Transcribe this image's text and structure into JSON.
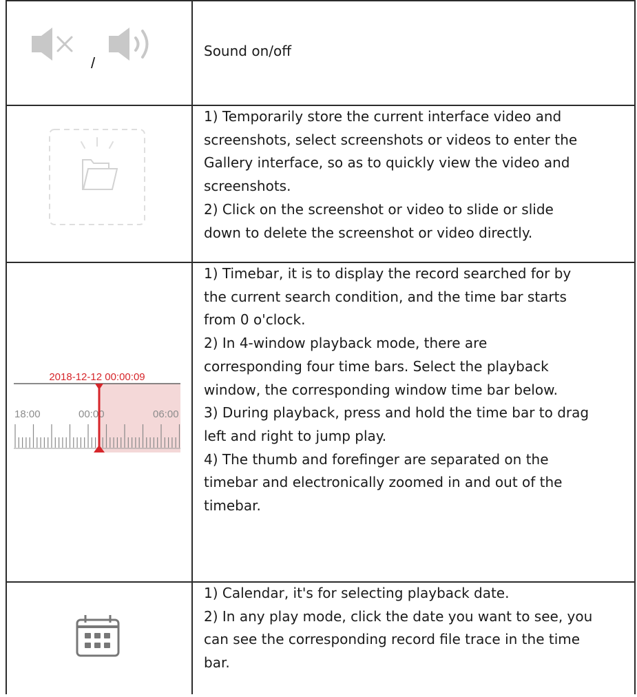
{
  "rows": [
    {
      "icon": "sound-off-on-icon",
      "separator": "/",
      "lines": [
        "Sound on/off"
      ]
    },
    {
      "icon": "gallery-folder-icon",
      "lines": [
        "1) Temporarily store the current interface video and",
        "screenshots, select screenshots or videos to enter the",
        "Gallery interface, so as to quickly view the video and",
        "screenshots.",
        "2) Click on the screenshot or video to slide or slide",
        "down to delete the screenshot or video directly."
      ]
    },
    {
      "icon": "timebar-icon",
      "timebar": {
        "date": "2018-12-12 00:00:09",
        "ticks": [
          "18:00",
          "00:00",
          "06:00"
        ],
        "accent": "#d6252a"
      },
      "lines": [
        "1) Timebar, it is to display the record searched for by",
        "the current search condition, and the time bar starts",
        "from 0 o'clock.",
        "2) In 4-window playback mode, there are",
        "corresponding four time bars. Select the playback",
        "window, the corresponding window time bar below.",
        "3) During playback, press and hold the time bar to drag",
        "left and right to jump play.",
        "4) The thumb and forefinger are separated on the",
        "timebar and electronically zoomed in and out of the",
        "timebar."
      ]
    },
    {
      "icon": "calendar-icon",
      "lines": [
        "1) Calendar, it's for selecting playback date.",
        "2) In any play mode, click the date you want to see, you",
        "can see the corresponding record file trace in the time",
        "bar."
      ]
    }
  ]
}
